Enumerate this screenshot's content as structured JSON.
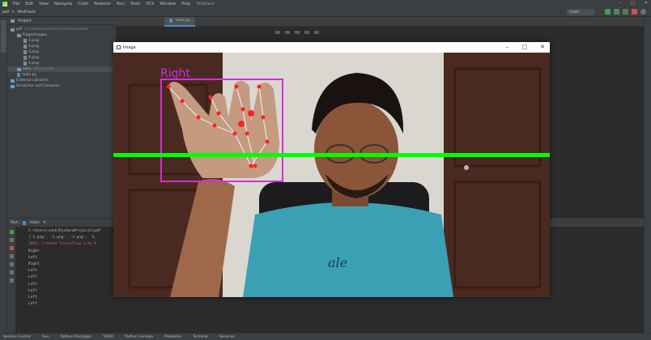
{
  "menubar": {
    "items": [
      "File",
      "Edit",
      "View",
      "Navigate",
      "Code",
      "Refactor",
      "Run",
      "Tools",
      "VCS",
      "Window",
      "Help"
    ],
    "file_title": "Hndtrack"
  },
  "navbar": {
    "crumbs": [
      "pdf",
      ">",
      "Hndtrack"
    ],
    "run_config": "main"
  },
  "project_panel": {
    "title": "Project",
    "tree": [
      {
        "label": "pdf",
        "dim": "C:\\Users\\sank\\PycharmProjects\\pdf",
        "icon": "folder",
        "indent": 0
      },
      {
        "label": "FingerImages",
        "dim": "",
        "icon": "folder",
        "indent": 1
      },
      {
        "label": "1.png",
        "dim": "",
        "icon": "file",
        "indent": 2
      },
      {
        "label": "2.png",
        "dim": "",
        "icon": "file",
        "indent": 2
      },
      {
        "label": "3.png",
        "dim": "",
        "icon": "file",
        "indent": 2
      },
      {
        "label": "4.png",
        "dim": "",
        "icon": "file",
        "indent": 2
      },
      {
        "label": "5.png",
        "dim": "",
        "icon": "file",
        "indent": 2
      },
      {
        "label": "venv",
        "dim": "library root",
        "icon": "folder",
        "indent": 1
      },
      {
        "label": "main.py",
        "dim": "",
        "icon": "py",
        "indent": 1
      },
      {
        "label": "External Libraries",
        "dim": "",
        "icon": "lib",
        "indent": 0
      },
      {
        "label": "Scratches and Consoles",
        "dim": "",
        "icon": "lib",
        "indent": 0
      }
    ]
  },
  "editor": {
    "tab_label": "main.py"
  },
  "run_panel": {
    "header_label": "Run:",
    "config_tab": "main",
    "console_lines": [
      {
        "text": "C:\\Users\\sank\\PycharmProjects\\pdf",
        "err": false
      },
      {
        "text": "['1.png', '2.png', '3.png', '4.",
        "err": false
      },
      {
        "text": "INFO: Created TensorFlow Lite X",
        "err": true
      },
      {
        "text": "Right",
        "err": false
      },
      {
        "text": "Left",
        "err": false
      },
      {
        "text": "Right",
        "err": false
      },
      {
        "text": "Left",
        "err": false
      },
      {
        "text": "Left",
        "err": false
      },
      {
        "text": "Left",
        "err": false
      },
      {
        "text": "Left",
        "err": false
      },
      {
        "text": "Left",
        "err": false
      },
      {
        "text": "Left",
        "err": false
      }
    ]
  },
  "statusbar": {
    "items": [
      "Version Control",
      "Run",
      "Python Packages",
      "TODO",
      "Python Console",
      "Problems",
      "Terminal",
      "Services"
    ]
  },
  "cv_window": {
    "title": "Image",
    "hand_label": "Right",
    "line_color": "#00ff00",
    "box_color": "#d12fd8",
    "landmark_color": "#ff2020"
  },
  "colors": {
    "ide_bg": "#2b2b2b",
    "ide_panel": "#3c3f41",
    "accent": "#4a88c7"
  }
}
